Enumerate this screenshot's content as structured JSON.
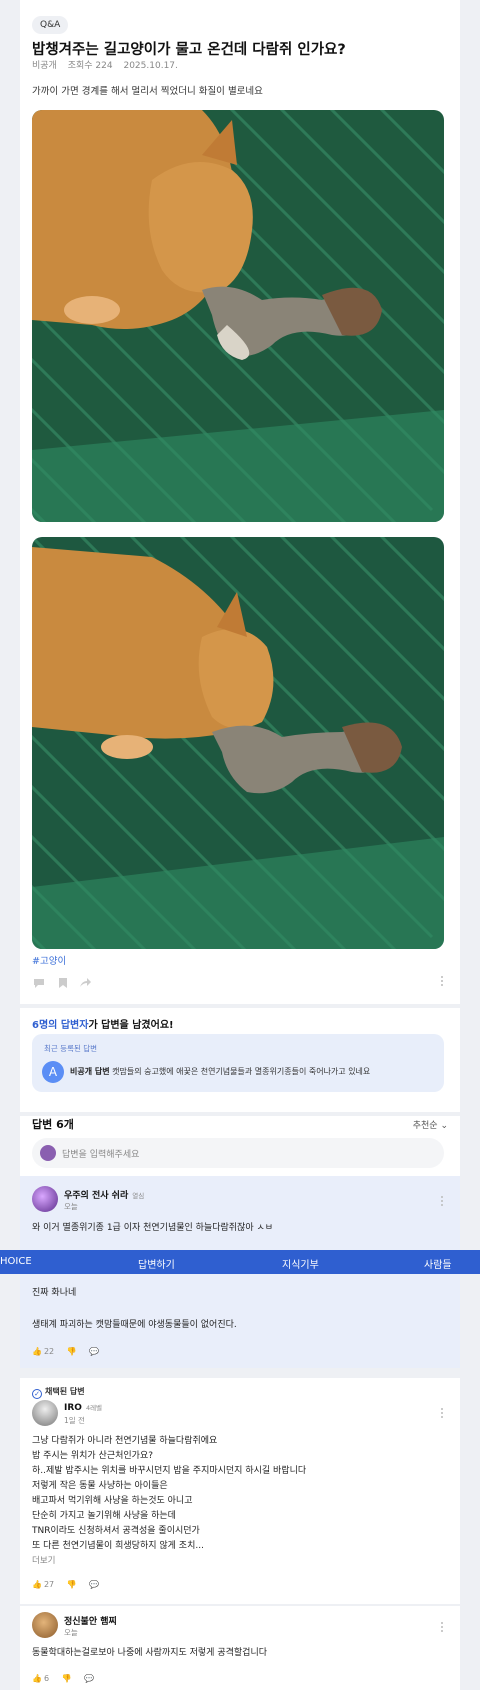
{
  "question": {
    "badge": "Q&A",
    "title": "밥챙겨주는 길고양이가 물고 온건데 다람쥐 인가요?",
    "author": "비공개",
    "views": "조회수 224",
    "date": "2025.10.17.",
    "body": "가까이 가면 경계를 해서 멀리서 찍었더니 화질이 별로네요",
    "hashtag": "#고양이"
  },
  "answered": {
    "count_text": "6명의 답변자",
    "suffix": "가 답변을 남겼어요!",
    "recent_label": "최근 등록된 답변",
    "recent_avatar": "A",
    "recent_author": "비공개 답변",
    "recent_text": " 캣맘들의 숭고했에 애꿎은 천연기념물들과 멸종위기종들이 죽어나가고 있네요"
  },
  "answers_header": {
    "title": "답변 6개",
    "sort": "추천순 ⌄",
    "input_placeholder": "답변을 입력해주세요"
  },
  "answer1": {
    "name": "우주의 전사 쉬라",
    "tag": "열심",
    "date": "오늘",
    "text": "와 이거 멸종위기종 1급 이자 천연기념물인 하늘다람쥐잖아 ㅅㅂ"
  },
  "navbar": {
    "left": "HOICE",
    "answer": "답변하기",
    "donate": "지식기부",
    "people": "사람들"
  },
  "answer1_cont": {
    "line1": "진짜 화나네",
    "line2": "생태계 파괴하는 캣맘들때문에 야생동물들이 없어진다.",
    "likes": "22"
  },
  "answer2": {
    "chosen": "채택된 답변",
    "name": "IRO",
    "tag": "4레벨",
    "date": "1일 전",
    "lines": [
      "그냥 다람쥐가 아니라 천연기념물 하늘다람쥐에요",
      "밥 주시는 위치가 산근처인가요?",
      "하..제발 밥주시는 위치를 바꾸시던지 밥을 주지마시던지 하시길 바랍니다",
      "저렇게 작은 동물 사냥하는 아이들은",
      "배고파서 먹기위해 사냥을 하는것도 아니고",
      "단순히 가지고 놀기위해 사냥을 하는데",
      "TNR이라도 신청하셔서 공격성을 줄이시던가",
      "또 다른 천연기념물이 희생당하지 않게 조치..."
    ],
    "more": "더보기",
    "likes": "27"
  },
  "answer3": {
    "name": "정신불안 햄찌",
    "date": "오늘",
    "text": "동물학대하는걸로보아 나중에 사람까지도 저렇게 공격할겁니다",
    "likes": "6"
  },
  "colors": {
    "accent": "#2f5fd0",
    "badge_bg": "#eef0f4",
    "highlight_bg": "#e9eefa"
  }
}
